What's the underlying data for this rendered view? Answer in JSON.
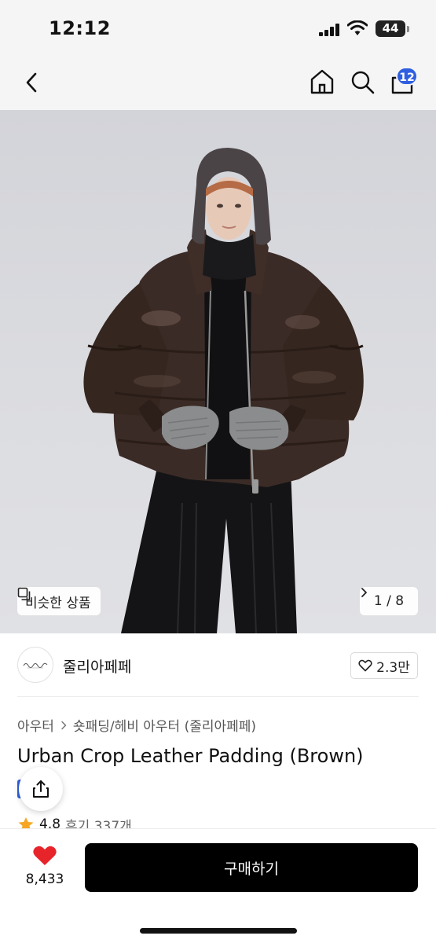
{
  "status_bar": {
    "time": "12:12",
    "battery": "44",
    "icons": [
      "signal-icon",
      "wifi-icon",
      "battery-icon"
    ]
  },
  "nav": {
    "icons": [
      "back-icon",
      "home-icon",
      "search-icon",
      "shopping-bag-icon"
    ],
    "cart_count": "12",
    "badge_color": "#2f5fe0"
  },
  "hero": {
    "similar_label": "비슷한 상품",
    "page_current": "1",
    "page_total": "8",
    "page_text": "1 / 8"
  },
  "brand": {
    "name": "줄리아페페",
    "likes": "2.3만"
  },
  "product": {
    "breadcrumb": [
      "아우터",
      "숏패딩/헤비 아우터 (줄리아페페)"
    ],
    "title": "Urban Crop Leather Padding (Brown)",
    "rating": "4.8",
    "reviews": "후기 337개"
  },
  "bottom": {
    "wishlist_count": "8,433",
    "buy_label": "구매하기",
    "heart_color": "#e8242b"
  }
}
